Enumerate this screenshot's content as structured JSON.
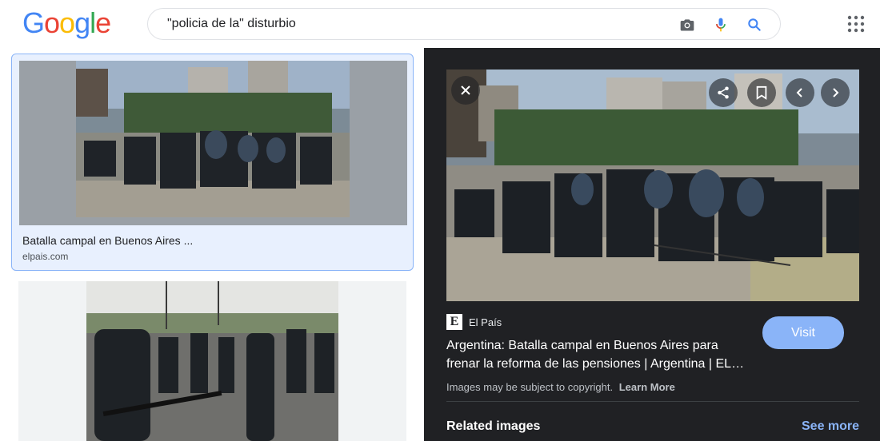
{
  "header": {
    "logo_letters": [
      "G",
      "o",
      "o",
      "g",
      "l",
      "e"
    ],
    "logo_colors": [
      "#4285F4",
      "#EA4335",
      "#FBBC05",
      "#4285F4",
      "#34A853",
      "#EA4335"
    ],
    "search_query": "\"policia de la\" disturbio",
    "icons": [
      "camera-icon",
      "microphone-icon",
      "search-icon",
      "apps-grid-icon"
    ]
  },
  "results": [
    {
      "caption": "Batalla campal en Buenos Aires ...",
      "domain": "elpais.com",
      "selected": true,
      "image_semantic": "riot-police-shields-street-clash"
    },
    {
      "image_semantic": "police-officers-line-street",
      "selected": false
    }
  ],
  "panel": {
    "source_logo": "E",
    "source_name": "El País",
    "title": "Argentina: Batalla campal en Buenos Aires para frenar la reforma de las pensiones | Argentina | EL…",
    "visit_label": "Visit",
    "copyright_text": "Images may be subject to copyright.",
    "learn_more": "Learn More",
    "related_label": "Related images",
    "see_more": "See more",
    "controls": [
      "close-icon",
      "share-icon",
      "bookmark-icon",
      "chevron-left-icon",
      "chevron-right-icon"
    ]
  },
  "colors": {
    "accent_blue": "#8ab4f8",
    "panel_bg": "#202124",
    "selected_card_bg": "#e8f0fe"
  }
}
